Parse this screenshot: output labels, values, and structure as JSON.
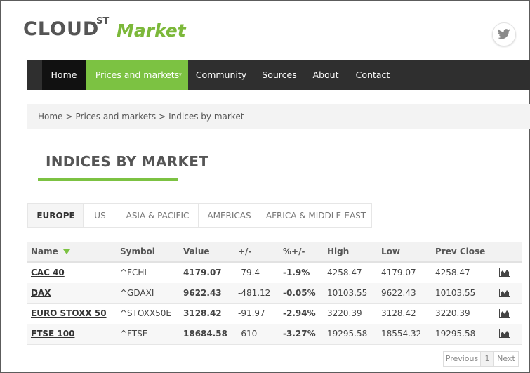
{
  "brand": {
    "cloud": "CLOUD",
    "st": "ST",
    "market": "Market"
  },
  "social": {
    "icon": "twitter-icon"
  },
  "nav": {
    "items": [
      {
        "label": "Home"
      },
      {
        "label": "Prices and markets",
        "caret": "▾"
      },
      {
        "label": "Community"
      },
      {
        "label": "Sources"
      },
      {
        "label": "About"
      },
      {
        "label": "Contact"
      }
    ]
  },
  "breadcrumb": {
    "items": [
      "Home",
      "Prices and markets",
      "Indices by market"
    ],
    "separator": ">"
  },
  "page": {
    "title": "INDICES BY MARKET"
  },
  "tabs": {
    "items": [
      {
        "label": "EUROPE"
      },
      {
        "label": "US"
      },
      {
        "label": "ASIA & PACIFIC"
      },
      {
        "label": "AMERICAS"
      },
      {
        "label": "AFRICA & MIDDLE-EAST"
      }
    ],
    "active": "EUROPE"
  },
  "table": {
    "headers": {
      "name": "Name",
      "symbol": "Symbol",
      "value": "Value",
      "change": "+/-",
      "pct": "%+/-",
      "high": "High",
      "low": "Low",
      "prev": "Prev Close"
    },
    "sort_icon": "sort-down-icon",
    "rows": [
      {
        "name": "CAC 40",
        "symbol": "^FCHI",
        "value": "4179.07",
        "change": "-79.4",
        "pct": "-1.9%",
        "high": "4258.47",
        "low": "4179.07",
        "prev": "4258.47"
      },
      {
        "name": "DAX",
        "symbol": "^GDAXI",
        "value": "9622.43",
        "change": "-481.12",
        "pct": "-0.05%",
        "high": "10103.55",
        "low": "9622.43",
        "prev": "10103.55"
      },
      {
        "name": "EURO STOXX 50",
        "symbol": "^STOXX50E",
        "value": "3128.42",
        "change": "-91.97",
        "pct": "-2.94%",
        "high": "3220.39",
        "low": "3128.42",
        "prev": "3220.39"
      },
      {
        "name": "FTSE 100",
        "symbol": "^FTSE",
        "value": "18684.58",
        "change": "-610",
        "pct": "-3.27%",
        "high": "19295.58",
        "low": "18554.32",
        "prev": "19295.58"
      }
    ],
    "row_icon": "area-chart-icon"
  },
  "pagination": {
    "previous": "Previous",
    "current": "1",
    "next": "Next"
  },
  "colors": {
    "accent": "#7cc242",
    "nav_bg": "#2f2f2f"
  }
}
